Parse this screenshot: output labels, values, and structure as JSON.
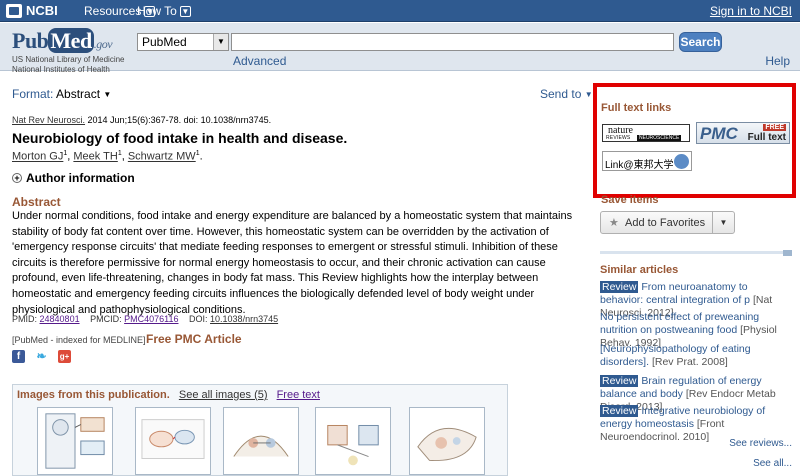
{
  "ncbi_bar": {
    "logo": "NCBI",
    "resources": "Resources",
    "howto": "How To",
    "signin": "Sign in to NCBI"
  },
  "header": {
    "logo_left": "Pub",
    "logo_med": "Med",
    "logo_gov": ".gov",
    "logo_sub1": "US National Library of Medicine",
    "logo_sub2": "National Institutes of Health",
    "db_selected": "PubMed",
    "search_value": "",
    "search_button": "Search",
    "advanced": "Advanced",
    "help": "Help"
  },
  "toolbar": {
    "format_label": "Format:",
    "format_value": "Abstract",
    "send_to": "Send to"
  },
  "article": {
    "journal": "Nat Rev Neurosci.",
    "citation": " 2014 Jun;15(6):367-78. doi: 10.1038/nrn3745.",
    "title": "Neurobiology of food intake in health and disease.",
    "authors": [
      {
        "name": "Morton GJ",
        "sup": "1"
      },
      {
        "name": "Meek TH",
        "sup": "1"
      },
      {
        "name": "Schwartz MW",
        "sup": "1"
      }
    ],
    "author_info": "Author information",
    "abstract_heading": "Abstract",
    "abstract": "Under normal conditions, food intake and energy expenditure are balanced by a homeostatic system that maintains stability of body fat content over time. However, this homeostatic system can be overridden by the activation of 'emergency response circuits' that mediate feeding responses to emergent or stressful stimuli. Inhibition of these circuits is therefore permissive for normal energy homeostasis to occur, and their chronic activation can cause profound, even life-threatening, changes in body fat mass. This Review highlights how the interplay between homeostatic and emergency feeding circuits influences the biologically defended level of body weight under physiological and pathophysiological conditions.",
    "pmid_label": "PMID:",
    "pmid": "24840801",
    "pmcid_label": "PMCID:",
    "pmcid": "PMC4076116",
    "doi_label": "DOI:",
    "doi": "10.1038/nrn3745",
    "indexed": "[PubMed - indexed for MEDLINE]",
    "free_pmc": "Free PMC Article"
  },
  "images": {
    "title": "Images from this publication.",
    "see_all": "See all images (5)",
    "free_text": "Free text"
  },
  "sidebar": {
    "fulltext_header": "Full text links",
    "nature_name": "nature",
    "nature_reviews": "REVIEWS",
    "nature_neuro": "NEUROSCIENCE",
    "pmc_name": "PMC",
    "pmc_free": "FREE",
    "pmc_fulltext": "Full text",
    "tokyo_text": "Link@東邦大学",
    "save_items": "Save items",
    "add_favorites": "Add to Favorites",
    "similar_header": "Similar articles",
    "similar": [
      {
        "review": "Review",
        "title": "From neuroanatomy to behavior: central integration of p",
        "src": "[Nat Neurosci. 2012]"
      },
      {
        "review": "",
        "title": "No persistent effect of preweaning nutrition on postweaning food",
        "src": "[Physiol Behav. 1992]"
      },
      {
        "review": "",
        "title": "[Neurophysiopathology of eating disorders].",
        "src": "[Rev Prat. 2008]"
      },
      {
        "review": "Review",
        "title": "Brain regulation of energy balance and body",
        "src": "[Rev Endocr Metab Disord. 2013]"
      },
      {
        "review": "Review",
        "title": "Integrative neurobiology of energy homeostasis",
        "src": "[Front Neuroendocrinol. 2010]"
      }
    ],
    "see_reviews": "See reviews...",
    "see_all": "See all..."
  },
  "colors": {
    "ncbi_blue": "#2f5a90",
    "section_brown": "#985735",
    "highlight_red": "#e00000"
  }
}
